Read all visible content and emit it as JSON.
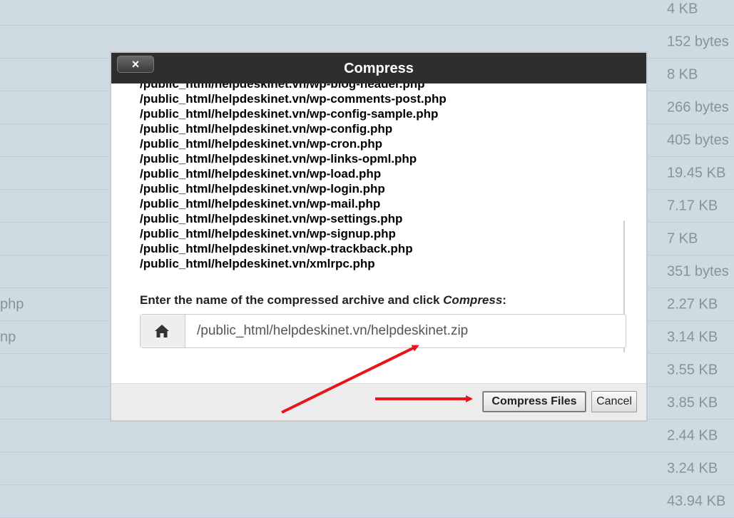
{
  "background_rows": [
    {
      "name": "",
      "size": "4 KB"
    },
    {
      "name": "",
      "size": "152 bytes"
    },
    {
      "name": "",
      "size": "8 KB"
    },
    {
      "name": "",
      "size": "266 bytes"
    },
    {
      "name": "",
      "size": "405 bytes"
    },
    {
      "name": "",
      "size": "19.45 KB"
    },
    {
      "name": "",
      "size": "7.17 KB"
    },
    {
      "name": "",
      "size": "7 KB"
    },
    {
      "name": "",
      "size": "351 bytes"
    },
    {
      "name": "php",
      "size": "2.27 KB"
    },
    {
      "name": "np",
      "size": "3.14 KB"
    },
    {
      "name": "",
      "size": "3.55 KB"
    },
    {
      "name": "",
      "size": "3.85 KB"
    },
    {
      "name": "",
      "size": "2.44 KB"
    },
    {
      "name": "",
      "size": "3.24 KB"
    },
    {
      "name": "",
      "size": "43.94 KB"
    }
  ],
  "dialog": {
    "title": "Compress",
    "close_label": "×",
    "files": [
      "/public_html/helpdeskinet.vn/wp-blog-header.php",
      "/public_html/helpdeskinet.vn/wp-comments-post.php",
      "/public_html/helpdeskinet.vn/wp-config-sample.php",
      "/public_html/helpdeskinet.vn/wp-config.php",
      "/public_html/helpdeskinet.vn/wp-cron.php",
      "/public_html/helpdeskinet.vn/wp-links-opml.php",
      "/public_html/helpdeskinet.vn/wp-load.php",
      "/public_html/helpdeskinet.vn/wp-login.php",
      "/public_html/helpdeskinet.vn/wp-mail.php",
      "/public_html/helpdeskinet.vn/wp-settings.php",
      "/public_html/helpdeskinet.vn/wp-signup.php",
      "/public_html/helpdeskinet.vn/wp-trackback.php",
      "/public_html/helpdeskinet.vn/xmlrpc.php"
    ],
    "prompt_prefix": "Enter the name of the compressed archive and click ",
    "prompt_emphasis": "Compress",
    "prompt_suffix": ":",
    "archive_path": "/public_html/helpdeskinet.vn/helpdeskinet.zip",
    "compress_button": "Compress Files",
    "cancel_button": "Cancel"
  },
  "icons": {
    "close": "close-icon",
    "home": "home-icon"
  },
  "colors": {
    "titlebar": "#2e2e2e",
    "annotation_arrow": "#e8141a",
    "page_bg": "#cfdbe3"
  }
}
